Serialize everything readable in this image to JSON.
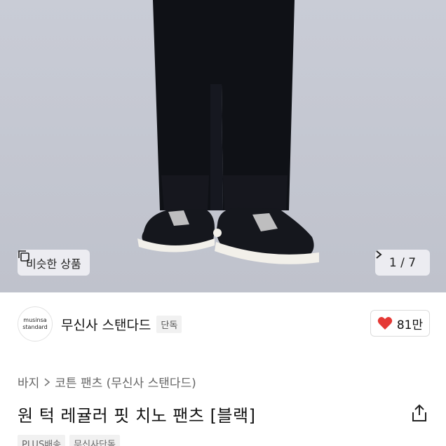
{
  "gallery": {
    "similar_label": "비슷한 상품",
    "counter_current": "1",
    "counter_total": "7",
    "counter_sep": "/"
  },
  "brand": {
    "logo_line1": "musinsa",
    "logo_line2": "standard",
    "name": "무신사 스탠다드",
    "badge": "단독",
    "likes": "81만"
  },
  "breadcrumb": {
    "category": "바지",
    "subcategory": "코튼 팬츠 (무신사 스탠다드)"
  },
  "product": {
    "title": "원 턱 레귤러 핏 치노 팬츠 [블랙]"
  },
  "tags": [
    "PLUS배송",
    "무신사단독"
  ],
  "colors": {
    "heart": "#e53935",
    "pants": "#0f1116",
    "hero_bg": "#c5c8d2"
  }
}
